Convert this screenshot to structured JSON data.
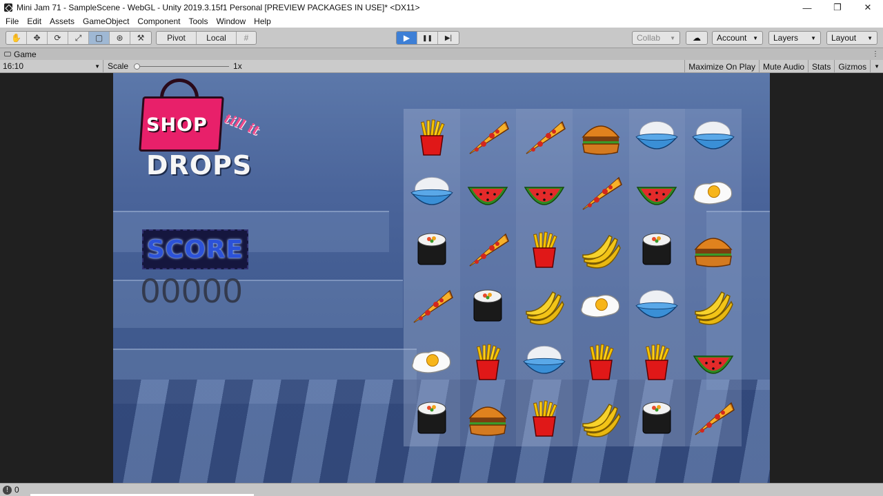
{
  "window": {
    "title": "Mini Jam 71 - SampleScene - WebGL - Unity 2019.3.15f1 Personal [PREVIEW PACKAGES IN USE]* <DX11>",
    "controls": [
      "—",
      "❐",
      "✕"
    ]
  },
  "menu": [
    "File",
    "Edit",
    "Assets",
    "GameObject",
    "Component",
    "Tools",
    "Window",
    "Help"
  ],
  "toolbar": {
    "tools": [
      {
        "name": "hand-tool",
        "glyph": "✋"
      },
      {
        "name": "move-tool",
        "glyph": "✥"
      },
      {
        "name": "rotate-tool",
        "glyph": "⟳"
      },
      {
        "name": "scale-tool",
        "glyph": "⤢"
      },
      {
        "name": "rect-tool",
        "glyph": "▢"
      },
      {
        "name": "transform-tool",
        "glyph": "⊛"
      },
      {
        "name": "custom-tool",
        "glyph": "⚒"
      }
    ],
    "pivot_label": "Pivot",
    "local_label": "Local",
    "play_glyph": "▶",
    "pause_glyph": "❚❚",
    "step_glyph": "▶|",
    "collab_label": "Collab",
    "account_label": "Account",
    "layers_label": "Layers",
    "layout_label": "Layout"
  },
  "tab": {
    "label": "Game"
  },
  "gamebar": {
    "aspect": "16:10",
    "scale_label": "Scale",
    "scale_value": "1x",
    "maximize": "Maximize On Play",
    "mute": "Mute Audio",
    "stats": "Stats",
    "gizmos": "Gizmos"
  },
  "game": {
    "logo": {
      "shop": "SHOP",
      "till": "till it",
      "drops": "DROPS"
    },
    "score_label": "SCORE",
    "score_value": "00000",
    "board": [
      [
        "fries",
        "pizza",
        "pizza",
        "burger",
        "rice",
        "rice"
      ],
      [
        "rice",
        "watermelon",
        "watermelon",
        "pizza",
        "watermelon",
        "egg"
      ],
      [
        "sushi",
        "pizza",
        "fries",
        "banana",
        "sushi",
        "burger"
      ],
      [
        "pizza",
        "sushi",
        "banana",
        "egg",
        "rice",
        "banana"
      ],
      [
        "egg",
        "fries",
        "rice",
        "fries",
        "fries",
        "watermelon"
      ],
      [
        "sushi",
        "burger",
        "fries",
        "banana",
        "sushi",
        "pizza"
      ]
    ]
  },
  "status": {
    "count": "0"
  },
  "colors": {
    "accent": "#3d7fd6",
    "bag": "#e8206a",
    "score_glow": "#2c52d8"
  }
}
